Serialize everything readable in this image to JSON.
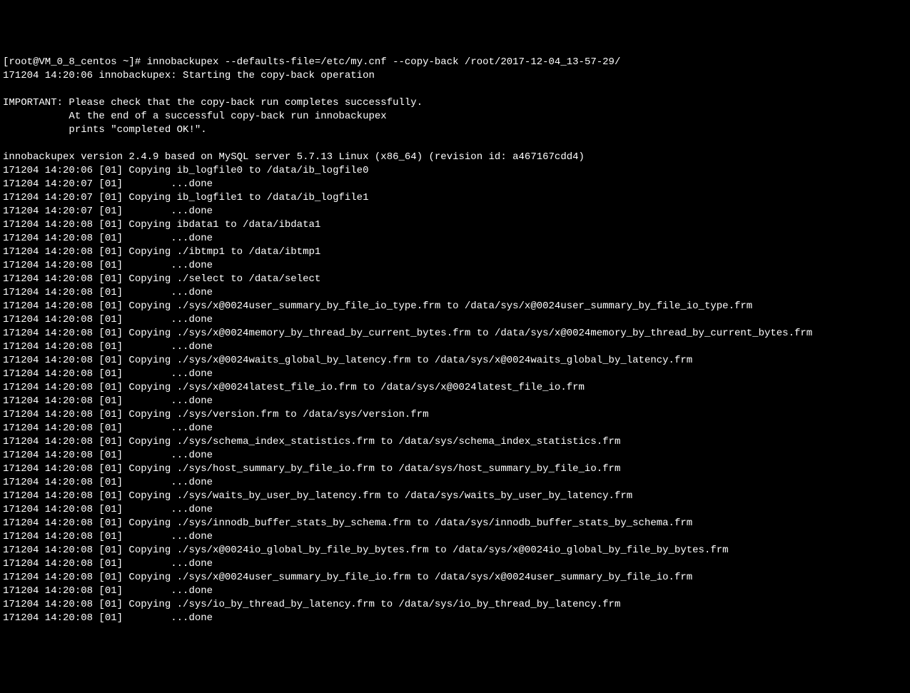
{
  "terminal": {
    "prompt": "[root@VM_0_8_centos ~]# ",
    "command": "innobackupex --defaults-file=/etc/my.cnf --copy-back /root/2017-12-04_13-57-29/",
    "start_line": "171204 14:20:06 innobackupex: Starting the copy-back operation",
    "important_header": "IMPORTANT: Please check that the copy-back run completes successfully.",
    "important_line2": "           At the end of a successful copy-back run innobackupex",
    "important_line3": "           prints \"completed OK!\".",
    "version_line": "innobackupex version 2.4.9 based on MySQL server 5.7.13 Linux (x86_64) (revision id: a467167cdd4)",
    "log_lines": [
      "171204 14:20:06 [01] Copying ib_logfile0 to /data/ib_logfile0",
      "171204 14:20:07 [01]        ...done",
      "171204 14:20:07 [01] Copying ib_logfile1 to /data/ib_logfile1",
      "171204 14:20:07 [01]        ...done",
      "171204 14:20:08 [01] Copying ibdata1 to /data/ibdata1",
      "171204 14:20:08 [01]        ...done",
      "171204 14:20:08 [01] Copying ./ibtmp1 to /data/ibtmp1",
      "171204 14:20:08 [01]        ...done",
      "171204 14:20:08 [01] Copying ./select to /data/select",
      "171204 14:20:08 [01]        ...done",
      "171204 14:20:08 [01] Copying ./sys/x@0024user_summary_by_file_io_type.frm to /data/sys/x@0024user_summary_by_file_io_type.frm",
      "171204 14:20:08 [01]        ...done",
      "171204 14:20:08 [01] Copying ./sys/x@0024memory_by_thread_by_current_bytes.frm to /data/sys/x@0024memory_by_thread_by_current_bytes.frm",
      "171204 14:20:08 [01]        ...done",
      "171204 14:20:08 [01] Copying ./sys/x@0024waits_global_by_latency.frm to /data/sys/x@0024waits_global_by_latency.frm",
      "171204 14:20:08 [01]        ...done",
      "171204 14:20:08 [01] Copying ./sys/x@0024latest_file_io.frm to /data/sys/x@0024latest_file_io.frm",
      "171204 14:20:08 [01]        ...done",
      "171204 14:20:08 [01] Copying ./sys/version.frm to /data/sys/version.frm",
      "171204 14:20:08 [01]        ...done",
      "171204 14:20:08 [01] Copying ./sys/schema_index_statistics.frm to /data/sys/schema_index_statistics.frm",
      "171204 14:20:08 [01]        ...done",
      "171204 14:20:08 [01] Copying ./sys/host_summary_by_file_io.frm to /data/sys/host_summary_by_file_io.frm",
      "171204 14:20:08 [01]        ...done",
      "171204 14:20:08 [01] Copying ./sys/waits_by_user_by_latency.frm to /data/sys/waits_by_user_by_latency.frm",
      "171204 14:20:08 [01]        ...done",
      "171204 14:20:08 [01] Copying ./sys/innodb_buffer_stats_by_schema.frm to /data/sys/innodb_buffer_stats_by_schema.frm",
      "171204 14:20:08 [01]        ...done",
      "171204 14:20:08 [01] Copying ./sys/x@0024io_global_by_file_by_bytes.frm to /data/sys/x@0024io_global_by_file_by_bytes.frm",
      "171204 14:20:08 [01]        ...done",
      "171204 14:20:08 [01] Copying ./sys/x@0024user_summary_by_file_io.frm to /data/sys/x@0024user_summary_by_file_io.frm",
      "171204 14:20:08 [01]        ...done",
      "171204 14:20:08 [01] Copying ./sys/io_by_thread_by_latency.frm to /data/sys/io_by_thread_by_latency.frm",
      "171204 14:20:08 [01]        ...done"
    ]
  }
}
